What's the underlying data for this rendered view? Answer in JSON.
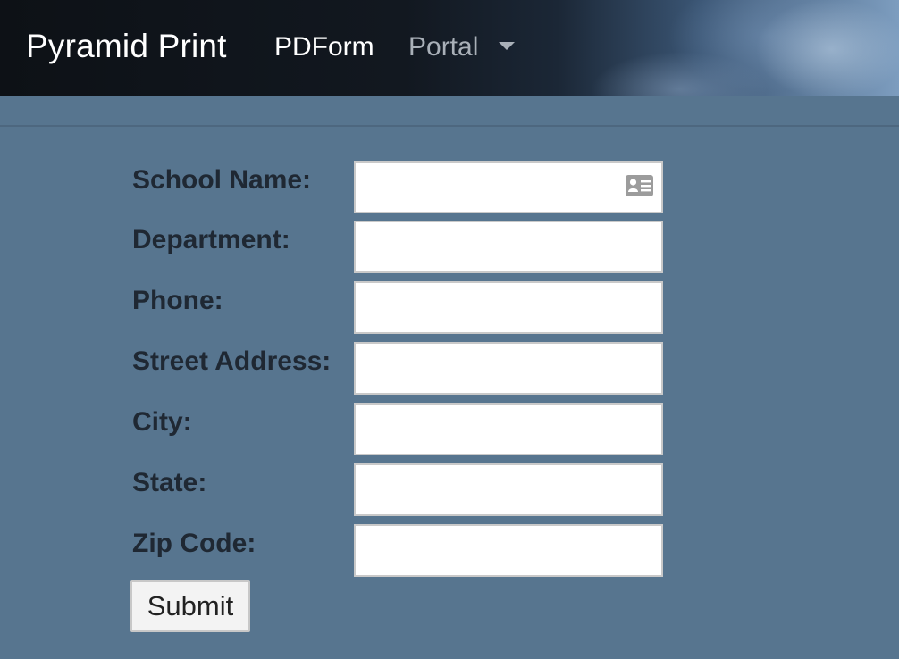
{
  "navbar": {
    "brand": "Pyramid Print",
    "links": [
      {
        "label": "PDForm"
      },
      {
        "label": "Portal"
      }
    ]
  },
  "form": {
    "fields": [
      {
        "label": "School Name:",
        "value": ""
      },
      {
        "label": "Department:",
        "value": ""
      },
      {
        "label": "Phone:",
        "value": ""
      },
      {
        "label": "Street Address:",
        "value": ""
      },
      {
        "label": "City:",
        "value": ""
      },
      {
        "label": "State:",
        "value": ""
      },
      {
        "label": "Zip Code:",
        "value": ""
      }
    ],
    "submit_label": "Submit"
  },
  "colors": {
    "page_background": "#57758f",
    "label_text": "#1f2833",
    "nav_active": "#ffffff",
    "nav_dropdown": "#a9b0b8"
  },
  "icons": {
    "school_name_autofill": "contact-card-icon",
    "portal_dropdown": "caret-down-icon"
  }
}
